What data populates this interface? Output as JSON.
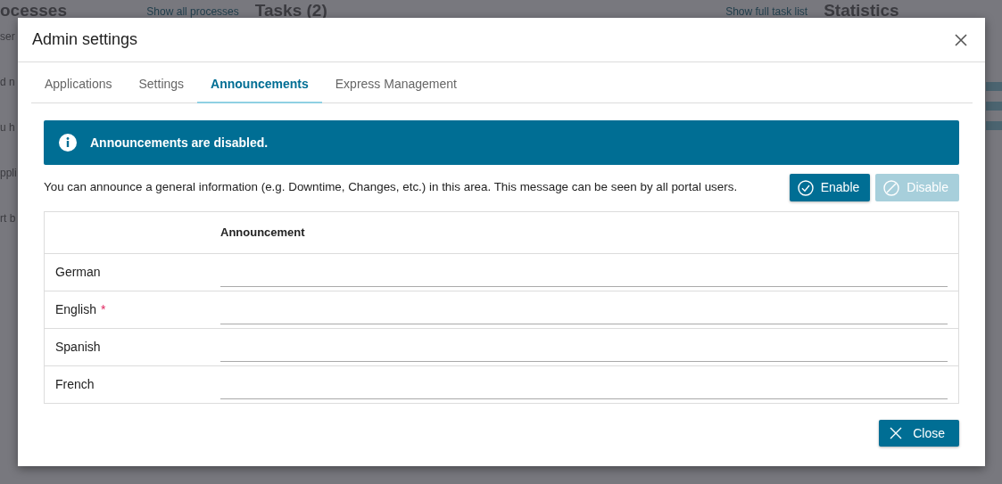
{
  "background": {
    "sections": [
      {
        "heading": "ocesses",
        "link": "Show all processes"
      },
      {
        "heading": "Tasks (2)",
        "link": "Show full task list"
      },
      {
        "heading": "Statistics"
      }
    ],
    "fragments": [
      "ser",
      "d n",
      "u h",
      "ppli",
      "rt b"
    ]
  },
  "dialog": {
    "title": "Admin settings",
    "tabs": [
      {
        "label": "Applications",
        "selected": false
      },
      {
        "label": "Settings",
        "selected": false
      },
      {
        "label": "Announcements",
        "selected": true
      },
      {
        "label": "Express Management",
        "selected": false
      }
    ],
    "alert": "Announcements are disabled.",
    "description": "You can announce a general information (e.g. Downtime, Changes, etc.) in this area. This message can be seen by all portal users.",
    "buttons": [
      {
        "label": "Enable",
        "kind": "enable",
        "disabled": false
      },
      {
        "label": "Disable",
        "kind": "disable",
        "disabled": true
      }
    ],
    "table": {
      "column_header": "Announcement",
      "rows": [
        {
          "language": "German"
        },
        {
          "language": "English",
          "marker": "*"
        },
        {
          "language": "Spanish"
        },
        {
          "language": "French"
        }
      ]
    },
    "close_button": "Close"
  }
}
